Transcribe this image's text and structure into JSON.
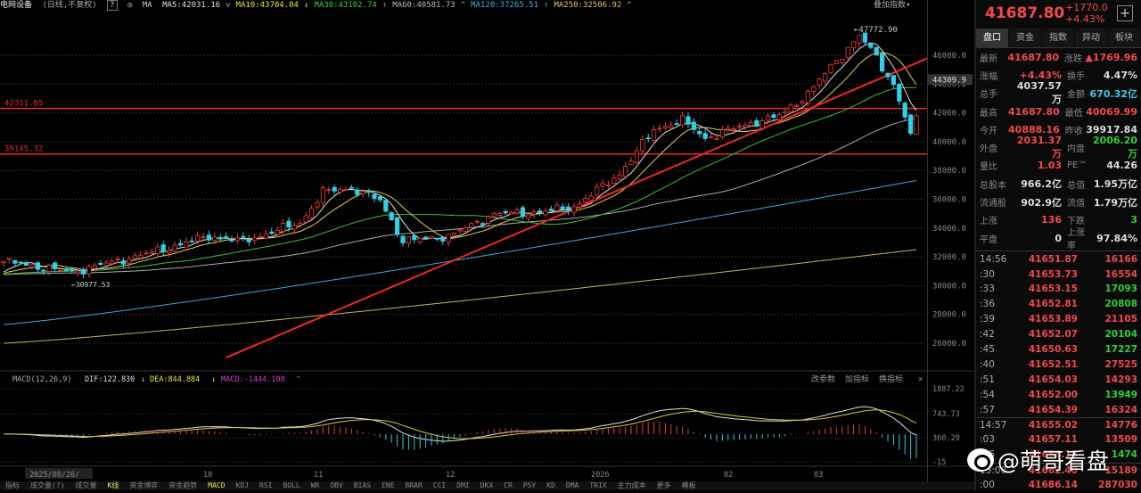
{
  "topbar": {
    "name": "电网设备",
    "mode": "(日线,不复权)",
    "help": "?",
    "settings": "◎",
    "ma_label": "MA",
    "ma": [
      {
        "label": "MA5:42031.16",
        "arrow": "v",
        "color": "#e0e0e0"
      },
      {
        "label": "MA10:43704.04",
        "arrow": "↓",
        "color": "#e8e83a"
      },
      {
        "label": "MA30:43102.74",
        "arrow": "↑",
        "color": "#3ad03a"
      },
      {
        "label": "MA60:40581.73",
        "arrow": "^",
        "color": "#bbbbbb"
      },
      {
        "label": "MA120:37265.51",
        "arrow": "↑",
        "color": "#3cb0e8"
      },
      {
        "label": "MA250:32506.92",
        "arrow": "^",
        "color": "#d8c070"
      }
    ],
    "overlay_btn": "叠加指数▾"
  },
  "main_chart": {
    "price_axis": [
      "46000.0",
      "44000.0",
      "42000.0",
      "40000.0",
      "38000.0",
      "36000.0",
      "34000.0",
      "32000.0",
      "30000.0",
      "28000.0",
      "26000.0"
    ],
    "current_price_tag": "44309.9",
    "high_label": "47772.90",
    "low_label": "30977.53",
    "hlines": [
      {
        "label": "42311.85",
        "value": 42311.85
      },
      {
        "label": "39145.32",
        "value": 39145.32
      }
    ],
    "date_labels": [
      "2025/08/26/",
      "10",
      "11",
      "12",
      "2026",
      "02",
      "03"
    ],
    "axis_min": 25000,
    "axis_max": 47800
  },
  "chart_data": {
    "type": "candlestick",
    "bars": 160,
    "close_anchors": [
      [
        0,
        31700
      ],
      [
        12,
        30950
      ],
      [
        25,
        32200
      ],
      [
        36,
        33430
      ],
      [
        42,
        33100
      ],
      [
        52,
        34360
      ],
      [
        56,
        36500
      ],
      [
        61,
        36800
      ],
      [
        66,
        35900
      ],
      [
        70,
        33100
      ],
      [
        78,
        33430
      ],
      [
        86,
        34970
      ],
      [
        94,
        35100
      ],
      [
        100,
        35470
      ],
      [
        108,
        37760
      ],
      [
        114,
        40860
      ],
      [
        119,
        41480
      ],
      [
        123,
        40240
      ],
      [
        130,
        41170
      ],
      [
        136,
        41790
      ],
      [
        141,
        43340
      ],
      [
        145,
        45200
      ],
      [
        150,
        47360
      ],
      [
        152,
        46430
      ],
      [
        156,
        43960
      ],
      [
        159,
        40550
      ],
      [
        160,
        41480
      ]
    ],
    "ma120_range": [
      27300,
      37300
    ],
    "ma250_range": [
      26000,
      32500
    ],
    "trendline": [
      [
        39,
        25000
      ],
      [
        162,
        45800
      ]
    ]
  },
  "macd": {
    "title": "MACD(12,26,9)",
    "dif": "DIF:122.830",
    "dif_arrow": "↓",
    "dea": "DEA:844.884",
    "dea_arrow": "↓",
    "macd": "MACD:-1444.108",
    "macd_arrow": "^",
    "buttons": [
      "改参数",
      "加指标",
      "换指标"
    ],
    "close": "×",
    "axis": [
      "1887.22",
      "743.73",
      "360.29",
      "-15"
    ]
  },
  "bottom_tabs": [
    "指标",
    "成交量(?)",
    "成交量",
    "K线",
    "资金博弈",
    "资金趋势",
    "MACD",
    "KDJ",
    "RSI",
    "BOLL",
    "WR",
    "OBV",
    "BIAS",
    "ENE",
    "BRAR",
    "CCI",
    "DMI",
    "DKX",
    "CR",
    "PSY",
    "KD",
    "DMA",
    "TRIX",
    "主力成本",
    "更多",
    "模板"
  ],
  "right": {
    "price": "41687.80",
    "change": "+1770.0",
    "change_pct": "+4.43%",
    "plus": "+",
    "tabs": [
      "盘口",
      "资金",
      "指数",
      "异动",
      "板块"
    ],
    "quotes": [
      {
        "l": "最新",
        "v": "41687.80",
        "vc": "red",
        "l2": "涨跌",
        "v2": "▲1769.96",
        "v2c": "red"
      },
      {
        "l": "涨幅",
        "v": "+4.43%",
        "vc": "red",
        "l2": "换手",
        "v2": "4.47%",
        "v2c": "white"
      },
      {
        "l": "总手",
        "v": "4037.57万",
        "vc": "white",
        "l2": "金额",
        "v2": "670.32亿",
        "v2c": "cyan"
      },
      {
        "l": "最高",
        "v": "41687.80",
        "vc": "red",
        "l2": "最低",
        "v2": "40069.99",
        "v2c": "red"
      },
      {
        "l": "今开",
        "v": "40888.16",
        "vc": "red",
        "l2": "昨收",
        "v2": "39917.84",
        "v2c": "white"
      },
      {
        "l": "外盘",
        "v": "2031.37万",
        "vc": "red",
        "l2": "内盘",
        "v2": "2006.20万",
        "v2c": "green"
      },
      {
        "l": "量比",
        "v": "1.03",
        "vc": "red",
        "l2": "PE™",
        "v2": "44.26",
        "v2c": "white"
      },
      {
        "l": "总股本",
        "v": "966.2亿",
        "vc": "white",
        "l2": "总值",
        "v2": "1.95万亿",
        "v2c": "white"
      },
      {
        "l": "流通股",
        "v": "902.9亿",
        "vc": "white",
        "l2": "流值",
        "v2": "1.79万亿",
        "v2c": "white"
      },
      {
        "l": "上涨",
        "v": "136",
        "vc": "red",
        "l2": "下跌",
        "v2": "3",
        "v2c": "green"
      },
      {
        "l": "平盘",
        "v": "0",
        "vc": "white",
        "l2": "上涨率",
        "v2": "97.84%",
        "v2c": "white"
      }
    ],
    "ticks": [
      {
        "t": "14:56",
        "p": "41651.87",
        "q": "16166",
        "c": "red"
      },
      {
        "t": ":30",
        "p": "41653.73",
        "q": "16554",
        "c": "red"
      },
      {
        "t": ":33",
        "p": "41653.15",
        "q": "17093",
        "c": "green"
      },
      {
        "t": ":36",
        "p": "41652.81",
        "q": "20808",
        "c": "green"
      },
      {
        "t": ":39",
        "p": "41653.89",
        "q": "21105",
        "c": "red"
      },
      {
        "t": ":42",
        "p": "41652.07",
        "q": "20104",
        "c": "green"
      },
      {
        "t": ":45",
        "p": "41650.63",
        "q": "17227",
        "c": "green"
      },
      {
        "t": ":40",
        "p": "41652.51",
        "q": "27525",
        "c": "red"
      },
      {
        "t": ":51",
        "p": "41654.03",
        "q": "14293",
        "c": "red"
      },
      {
        "t": ":54",
        "p": "41652.00",
        "q": "13949",
        "c": "green"
      },
      {
        "t": ":57",
        "p": "41654.39",
        "q": "16324",
        "c": "red"
      },
      {
        "t": "14:57",
        "p": "41655.02",
        "q": "14776",
        "c": "red"
      },
      {
        "t": ":03",
        "p": "41657.11",
        "q": "13509",
        "c": "red"
      },
      {
        "t": ":06",
        "p": "41658.18",
        "q": "1474",
        "c": "green"
      },
      {
        "t": "15:00",
        "p": "41662.48",
        "q": "15189",
        "c": "red"
      },
      {
        "t": ":00",
        "p": "41686.14",
        "q": "287030",
        "c": "red"
      }
    ]
  },
  "watermark": "@萌哥看盘"
}
